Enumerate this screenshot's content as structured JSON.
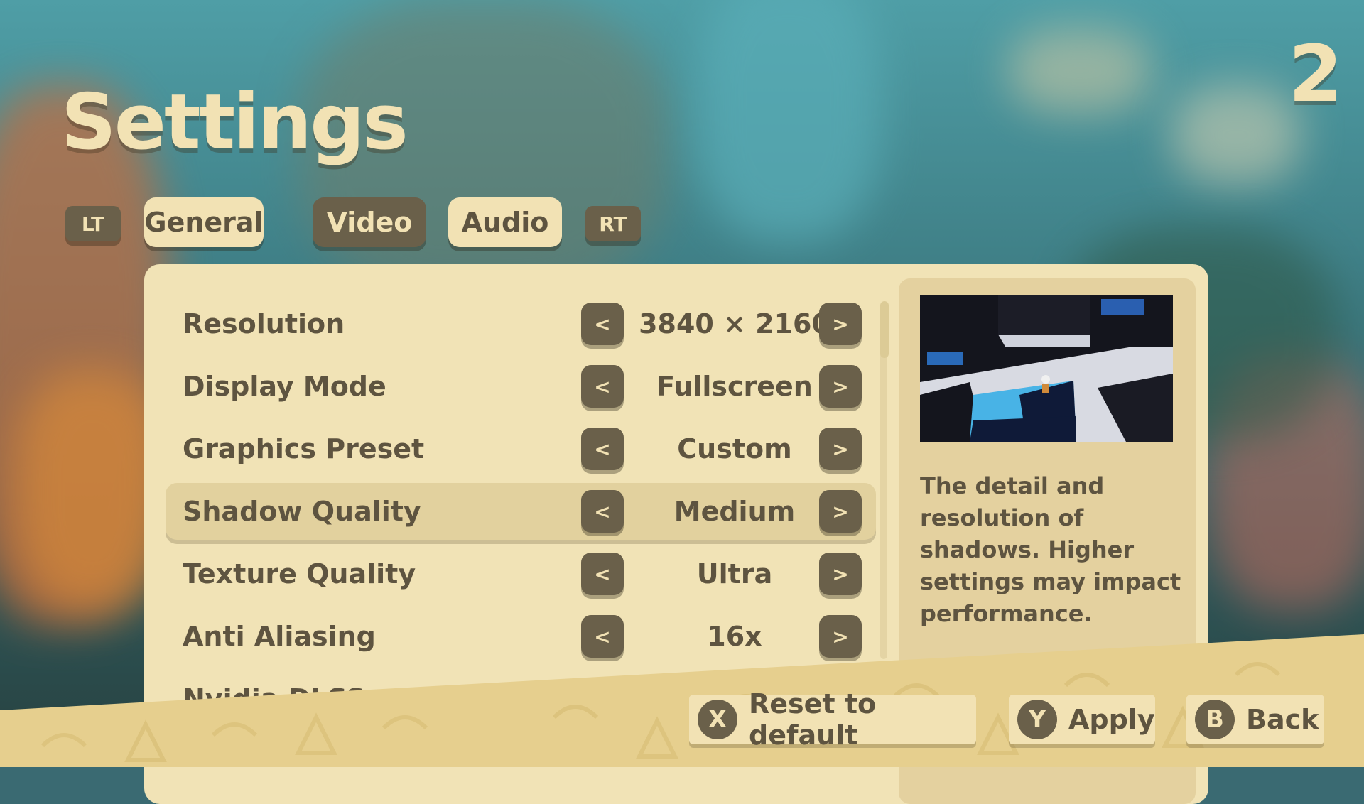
{
  "header": {
    "title": "Settings",
    "page_number": "2"
  },
  "tabs": {
    "lt": "LT",
    "rt": "RT",
    "items": [
      {
        "label": "General",
        "state": "inactive"
      },
      {
        "label": "Video",
        "state": "active"
      },
      {
        "label": "Audio",
        "state": "inactive"
      }
    ]
  },
  "settings": [
    {
      "label": "Resolution",
      "value": "3840 × 2160"
    },
    {
      "label": "Display Mode",
      "value": "Fullscreen"
    },
    {
      "label": "Graphics Preset",
      "value": "Custom"
    },
    {
      "label": "Shadow Quality",
      "value": "Medium",
      "selected": true
    },
    {
      "label": "Texture Quality",
      "value": "Ultra"
    },
    {
      "label": "Anti Aliasing",
      "value": "16x"
    },
    {
      "label": "Nvidia DLSS",
      "value": ""
    }
  ],
  "arrows": {
    "left": "<",
    "right": ">"
  },
  "info": {
    "description": "The detail and resolution of shadows. Higher settings may impact performance."
  },
  "footer": {
    "reset": {
      "glyph": "X",
      "label": "Reset to default"
    },
    "apply": {
      "glyph": "Y",
      "label": "Apply"
    },
    "back": {
      "glyph": "B",
      "label": "Back"
    }
  },
  "colors": {
    "cream": "#f2e2b4",
    "panel": "#f1e3b6",
    "brown": "#6a604a",
    "text": "#5e5440",
    "footer": "#e6cf8e"
  }
}
